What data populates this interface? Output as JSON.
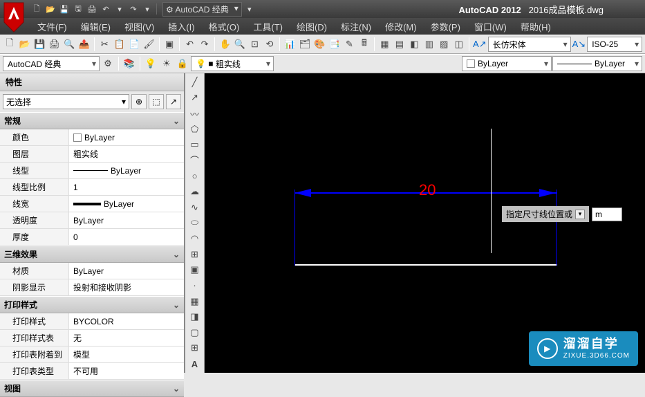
{
  "title": {
    "app": "AutoCAD 2012",
    "file": "2016成品模板.dwg"
  },
  "workspace_dd": "AutoCAD 经典",
  "menu": [
    "文件(F)",
    "编辑(E)",
    "视图(V)",
    "插入(I)",
    "格式(O)",
    "工具(T)",
    "绘图(D)",
    "标注(N)",
    "修改(M)",
    "参数(P)",
    "窗口(W)",
    "帮助(H)"
  ],
  "tb2": {
    "workspace": "AutoCAD 经典",
    "layer": "粗实线",
    "bylayer": "ByLayer",
    "linetype_label": "ByLayer"
  },
  "annot": {
    "style": "长仿宋体",
    "dimstyle": "ISO-25"
  },
  "props": {
    "title": "特性",
    "selection": "无选择",
    "cats": {
      "general": "常规",
      "effects3d": "三维效果",
      "plot": "打印样式",
      "view": "视图"
    },
    "general": {
      "color_k": "颜色",
      "color_v": "ByLayer",
      "layer_k": "图层",
      "layer_v": "粗实线",
      "lt_k": "线型",
      "lt_v": "ByLayer",
      "lts_k": "线型比例",
      "lts_v": "1",
      "lw_k": "线宽",
      "lw_v": "ByLayer",
      "tr_k": "透明度",
      "tr_v": "ByLayer",
      "th_k": "厚度",
      "th_v": "0"
    },
    "fx": {
      "mat_k": "材质",
      "mat_v": "ByLayer",
      "sh_k": "阴影显示",
      "sh_v": "投射和接收阴影"
    },
    "plot": {
      "ps_k": "打印样式",
      "ps_v": "BYCOLOR",
      "pt_k": "打印样式表",
      "pt_v": "无",
      "pa_k": "打印表附着到",
      "pa_v": "模型",
      "py_k": "打印表类型",
      "py_v": "不可用"
    }
  },
  "canvas": {
    "dim_value": "20",
    "prompt": "指定尺寸线位置或",
    "input_value": "m"
  },
  "watermark": {
    "name": "溜溜自学",
    "url": "ZIXUE.3D66.COM"
  }
}
